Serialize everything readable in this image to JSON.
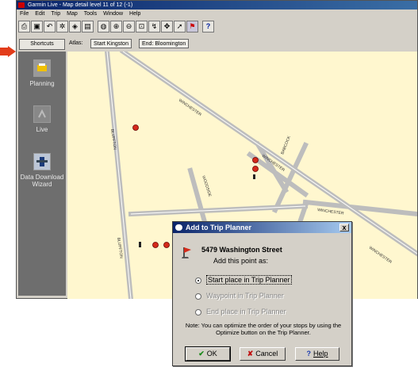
{
  "window": {
    "title": "Garmin Live - Map detail level 11 of 12 (-1)"
  },
  "menu": [
    "File",
    "Edit",
    "Trip",
    "Map",
    "Tools",
    "Window",
    "Help"
  ],
  "toolbar_icons": [
    "print-icon",
    "save-icon",
    "undo-icon",
    "settings-icon",
    "gps-icon",
    "printer2-icon",
    "globe-icon",
    "zoom-in-icon",
    "zoom-out-icon",
    "zoom-area-icon",
    "route-icon",
    "pan-icon",
    "pointer-icon",
    "flag-icon",
    "help-icon"
  ],
  "tabs": {
    "shortcuts": "Shortcuts",
    "atlas_label": "Atlas:",
    "items": [
      "Start Kingston",
      "End: Bloomington"
    ]
  },
  "sidebar": {
    "items": [
      {
        "label": "Planning"
      },
      {
        "label": "Live"
      },
      {
        "label": "Data Download Wizard"
      }
    ]
  },
  "map": {
    "streets": [
      "WINCHESTER",
      "WINCHESTER",
      "WINCHESTER",
      "WINCHESTER",
      "BLUFFTON",
      "BLUFFTON",
      "WOODSIDE",
      "BABCOCK"
    ]
  },
  "dialog": {
    "title": "Add to Trip Planner",
    "close": "x",
    "street": "5479 Washington Street",
    "prompt": "Add this point as:",
    "options": [
      {
        "label": "Start place in Trip Planner",
        "selected": true,
        "enabled": true
      },
      {
        "label": "Waypoint in Trip Planner",
        "selected": false,
        "enabled": false
      },
      {
        "label": "End place in Trip Planner",
        "selected": false,
        "enabled": false
      }
    ],
    "note": "Note: You can optimize the order of your stops by using the Optimize button on the Trip Planner.",
    "buttons": {
      "ok": "OK",
      "cancel": "Cancel",
      "help": "Help"
    }
  },
  "colors": {
    "map_background": "#fff7cf",
    "road": "#bdbdbd",
    "sidebar": "#6e6e6e",
    "arrow": "#e23c1a",
    "titlebar": "#0a246a"
  }
}
